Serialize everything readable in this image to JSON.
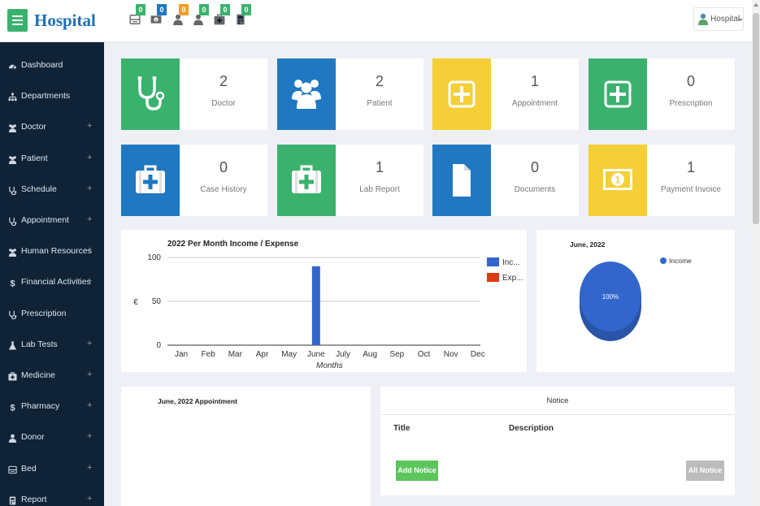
{
  "header": {
    "brand": "Hospital",
    "user_name": "Hospital",
    "quick_icons": [
      {
        "icon": "bed-icon",
        "count": "0",
        "color": "#3ab26e"
      },
      {
        "icon": "money-icon",
        "count": "0",
        "color": "#1f78c1"
      },
      {
        "icon": "user-icon",
        "count": "0",
        "color": "#f0a020"
      },
      {
        "icon": "user-icon",
        "count": "0",
        "color": "#3ab26e"
      },
      {
        "icon": "medkit-icon",
        "count": "0",
        "color": "#3ab26e"
      },
      {
        "icon": "report-icon",
        "count": "0",
        "color": "#3ab26e"
      }
    ]
  },
  "sidebar": {
    "items": [
      {
        "label": "Dashboard",
        "icon": "dashboard-icon",
        "expandable": false
      },
      {
        "label": "Departments",
        "icon": "sitemap-icon",
        "expandable": false
      },
      {
        "label": "Doctor",
        "icon": "users-icon",
        "expandable": true
      },
      {
        "label": "Patient",
        "icon": "users-icon",
        "expandable": true
      },
      {
        "label": "Schedule",
        "icon": "stethoscope-icon",
        "expandable": true
      },
      {
        "label": "Appointment",
        "icon": "stethoscope-icon",
        "expandable": true
      },
      {
        "label": "Human Resources",
        "icon": "users-icon",
        "expandable": true
      },
      {
        "label": "Financial Activities",
        "icon": "dollar-icon",
        "expandable": true
      },
      {
        "label": "Prescription",
        "icon": "stethoscope-icon",
        "expandable": false
      },
      {
        "label": "Lab Tests",
        "icon": "flask-icon",
        "expandable": true
      },
      {
        "label": "Medicine",
        "icon": "medkit-icon",
        "expandable": true
      },
      {
        "label": "Pharmacy",
        "icon": "dollar-icon",
        "expandable": true
      },
      {
        "label": "Donor",
        "icon": "user-icon",
        "expandable": true
      },
      {
        "label": "Bed",
        "icon": "bed-icon",
        "expandable": true
      },
      {
        "label": "Report",
        "icon": "report-icon",
        "expandable": true
      }
    ],
    "plus": "+"
  },
  "cards": [
    {
      "label": "Doctor",
      "value": "2",
      "color": "#3ab26e",
      "icon": "stethoscope-icon"
    },
    {
      "label": "Patient",
      "value": "2",
      "color": "#1f78c1",
      "icon": "users-icon"
    },
    {
      "label": "Appointment",
      "value": "1",
      "color": "#f4cf37",
      "icon": "plus-square-icon"
    },
    {
      "label": "Prescription",
      "value": "0",
      "color": "#3ab26e",
      "icon": "plus-square-icon"
    },
    {
      "label": "Case History",
      "value": "0",
      "color": "#1f78c1",
      "icon": "medkit-icon"
    },
    {
      "label": "Lab Report",
      "value": "1",
      "color": "#3ab26e",
      "icon": "medkit-icon"
    },
    {
      "label": "Documents",
      "value": "0",
      "color": "#1f78c1",
      "icon": "file-icon"
    },
    {
      "label": "Payment Invoice",
      "value": "1",
      "color": "#f4cf37",
      "icon": "money-icon"
    }
  ],
  "income_chart": {
    "title": "2022 Per Month Income / Expense",
    "chart_data": {
      "type": "bar",
      "title": "2022 Per Month Income / Expense",
      "categories": [
        "Jan",
        "Feb",
        "Mar",
        "Apr",
        "May",
        "June",
        "July",
        "Aug",
        "Sep",
        "Oct",
        "Nov",
        "Dec"
      ],
      "series": [
        {
          "name": "Inc...",
          "color": "#3366cc",
          "values": [
            0,
            0,
            0,
            0,
            0,
            90,
            0,
            0,
            0,
            0,
            0,
            0
          ]
        },
        {
          "name": "Exp...",
          "color": "#dc3912",
          "values": [
            0,
            0,
            0,
            0,
            0,
            0,
            0,
            0,
            0,
            0,
            0,
            0
          ]
        }
      ],
      "xlabel": "Months",
      "ylabel": "€",
      "ylim": [
        0,
        100
      ],
      "yticks": [
        "0",
        "50",
        "100"
      ],
      "grid": true,
      "legend": "right"
    }
  },
  "pie_chart": {
    "title": "June, 2022",
    "chart_data": {
      "type": "pie",
      "title": "June, 2022",
      "labels": [
        "Income"
      ],
      "values": [
        100
      ],
      "slice_label": "100%",
      "color": "#3366cc",
      "legend": "top-right"
    }
  },
  "appointment_panel": {
    "title": "June, 2022 Appointment"
  },
  "notice_panel": {
    "title": "Notice",
    "columns": [
      "Title",
      "Description"
    ],
    "add_button": "Add Notice",
    "all_button": "All Notice"
  }
}
